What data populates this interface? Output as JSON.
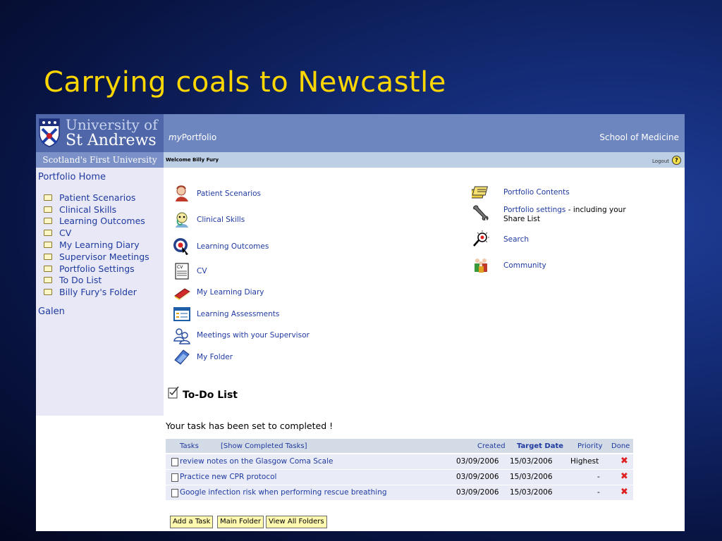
{
  "slide": {
    "title": "Carrying coals to Newcastle"
  },
  "header": {
    "university_line1": "University of",
    "university_line2": "St Andrews",
    "tagline": "Scotland's First University",
    "brand_prefix": "my",
    "brand_suffix": "Portfolio",
    "school": "School of Medicine",
    "welcome": "Welcome Billy Fury",
    "logout": "Logout",
    "help": "?"
  },
  "sidebar": {
    "home": "Portfolio Home",
    "items": [
      "Patient Scenarios",
      "Clinical Skills",
      "Learning Outcomes",
      "CV",
      "My Learning Diary",
      "Supervisor Meetings",
      "Portfolio Settings",
      "To Do List",
      "Billy Fury's Folder"
    ],
    "galen": "Galen"
  },
  "main_links": [
    {
      "label": "Patient Scenarios",
      "icon": "patient-scenarios-icon"
    },
    {
      "label": "Clinical Skills",
      "icon": "clinical-skills-icon"
    },
    {
      "label": "Learning Outcomes",
      "icon": "target-icon"
    },
    {
      "label": "CV",
      "icon": "cv-document-icon"
    },
    {
      "label": "My Learning Diary",
      "icon": "diary-book-icon"
    },
    {
      "label": "Learning Assessments",
      "icon": "assessment-form-icon"
    },
    {
      "label": "Meetings with your Supervisor",
      "icon": "people-meeting-icon"
    },
    {
      "label": "My Folder",
      "icon": "folder-icon"
    }
  ],
  "right_links": {
    "contents": "Portfolio Contents",
    "settings": "Portfolio settings",
    "settings_note": " - including your Share List",
    "search": "Search",
    "community": "Community"
  },
  "todo": {
    "title": "To-Do List",
    "status": "Your task has been set to completed !",
    "headers": {
      "tasks": "Tasks",
      "show_completed": "[Show Completed Tasks]",
      "created": "Created",
      "target": "Target Date",
      "priority": "Priority",
      "done": "Done"
    },
    "rows": [
      {
        "name": "review notes on the Glasgow Coma Scale",
        "created": "03/09/2006",
        "target": "15/03/2006",
        "priority": "Highest"
      },
      {
        "name": "Practice new CPR protocol",
        "created": "03/09/2006",
        "target": "15/03/2006",
        "priority": "-"
      },
      {
        "name": "Google infection risk when performing rescue breathing",
        "created": "03/09/2006",
        "target": "15/03/2006",
        "priority": "-"
      }
    ],
    "done_mark": "✖",
    "buttons": {
      "add": "Add a Task",
      "main": "Main Folder",
      "all": "View All Folders"
    }
  }
}
